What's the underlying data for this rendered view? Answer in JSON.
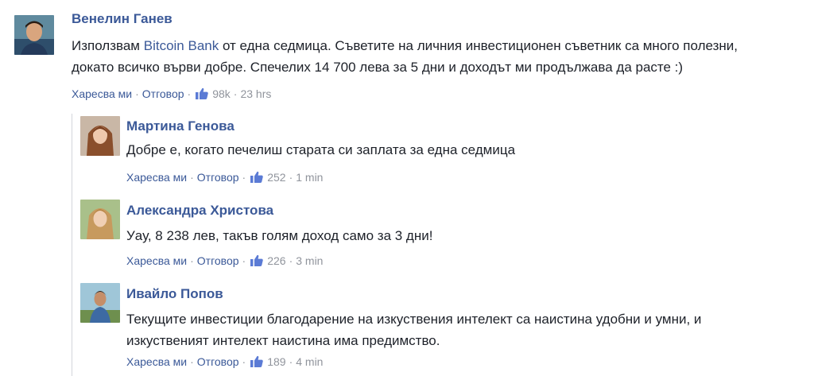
{
  "comments": [
    {
      "author": "Венелин Ганев",
      "text_before": "Използвам ",
      "text_link": "Bitcoin Bank",
      "text_line1_after": " от една седмица. Съветите на личния инвестиционен съветник са много полезни,",
      "text_line2": "докато всичко върви добре. Спечелих 14 700 лева за 5 дни и доходът ми продължава да расте :)",
      "like_label": "Харесва ми",
      "reply_label": "Отговор",
      "likes": "98k",
      "time": "23 hrs"
    },
    {
      "author": "Мартина Генова",
      "text_line1": "Добре е, когато печелиш старата си заплата за една седмица",
      "like_label": "Харесва ми",
      "reply_label": "Отговор",
      "likes": "252",
      "time": "1 min"
    },
    {
      "author": "Александра Христова",
      "text_line1": "Уау, 8 238 лев, такъв голям доход само за 3 дни!",
      "like_label": "Харесва ми",
      "reply_label": "Отговор",
      "likes": "226",
      "time": "3 min"
    },
    {
      "author": "Ивайло Попов",
      "text_line1": "Текущите инвестиции благодарение на изкуствения интелект са наистина удобни и умни, и",
      "text_line2": "изкуственият интелект наистина има предимство.",
      "like_label": "Харесва ми",
      "reply_label": "Отговор",
      "likes": "189",
      "time": "4 min"
    }
  ],
  "colors": {
    "link": "#3b5998",
    "text": "#1d2129",
    "meta": "#90949c",
    "thumb": "#5b7bd5"
  },
  "icons": {
    "thumb": "thumbs-up-icon"
  }
}
